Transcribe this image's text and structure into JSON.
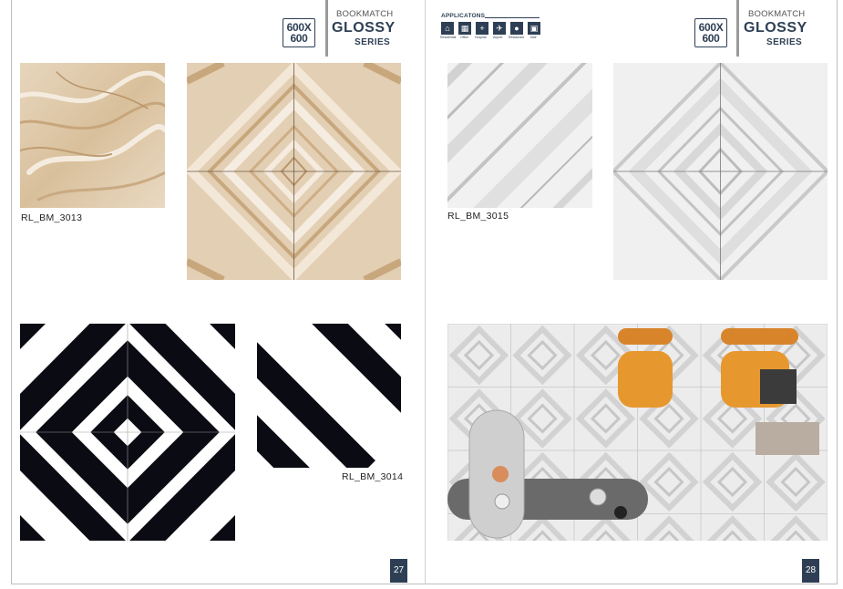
{
  "left_page": {
    "series": {
      "size_top": "600X",
      "size_bottom": "600",
      "label": "BOOKMATCH",
      "name": "GLOSSY",
      "suffix": "SERIES"
    },
    "tiles": [
      {
        "code": "RL_BM_3013"
      },
      {
        "code": "RL_BM_3014"
      }
    ],
    "page_number": "27"
  },
  "right_page": {
    "applications": {
      "title": "APPLICATONS",
      "items": [
        {
          "icon": "residential-icon",
          "label": "Residential"
        },
        {
          "icon": "office-icon",
          "label": "Office"
        },
        {
          "icon": "hospital-icon",
          "label": "Hospital"
        },
        {
          "icon": "airport-icon",
          "label": "Airport"
        },
        {
          "icon": "restaurant-icon",
          "label": "Restaurant"
        },
        {
          "icon": "mall-icon",
          "label": "Mall"
        }
      ]
    },
    "series": {
      "size_top": "600X",
      "size_bottom": "600",
      "label": "BOOKMATCH",
      "name": "GLOSSY",
      "suffix": "SERIES"
    },
    "tiles": [
      {
        "code": "RL_BM_3015"
      }
    ],
    "page_number": "28"
  },
  "colors": {
    "brand_navy": "#2e3f55",
    "beige_marble": "#e3cfb3",
    "grey_marble": "#d9d9d9"
  }
}
